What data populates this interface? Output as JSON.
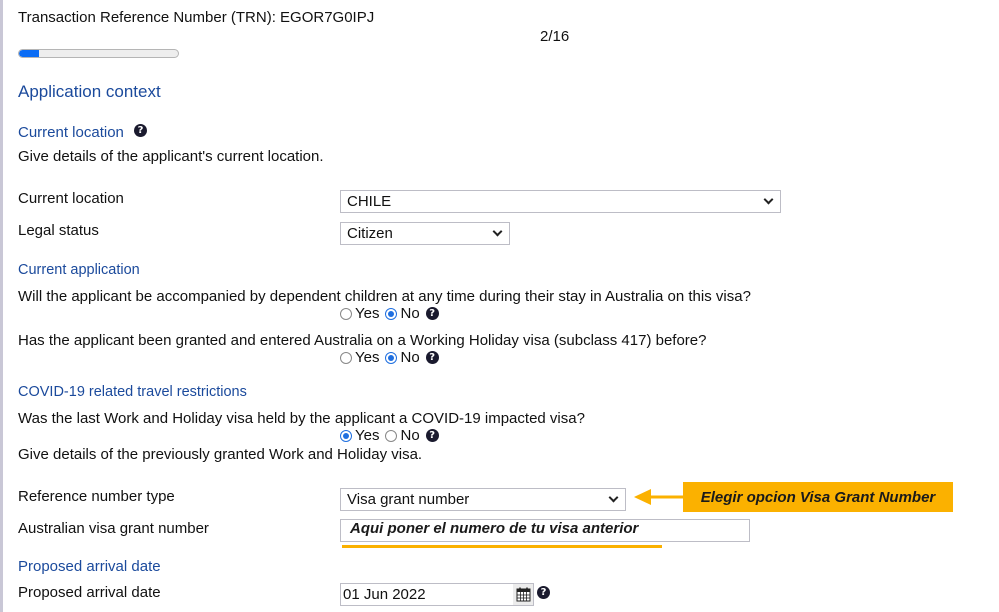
{
  "header": {
    "trn_label": "Transaction Reference Number (TRN): EGOR7G0IPJ",
    "page_counter": "2/16",
    "progress_fraction": 0.125
  },
  "section_title": "Application context",
  "current_location_section": {
    "heading": "Current location",
    "description": "Give details of the applicant's current location.",
    "fields": {
      "current_location": {
        "label": "Current location",
        "value": "CHILE"
      },
      "legal_status": {
        "label": "Legal status",
        "value": "Citizen"
      }
    }
  },
  "current_application": {
    "heading": "Current application",
    "q1": {
      "text": "Will the applicant be accompanied by dependent children at any time during their stay in Australia on this visa?",
      "yes": "Yes",
      "no": "No",
      "selected": "No"
    },
    "q2": {
      "text": "Has the applicant been granted and entered Australia on a Working Holiday visa (subclass 417) before?",
      "yes": "Yes",
      "no": "No",
      "selected": "No"
    }
  },
  "covid": {
    "heading": "COVID-19 related travel restrictions",
    "q1": {
      "text": "Was the last Work and Holiday visa held by the applicant a COVID-19 impacted visa?",
      "yes": "Yes",
      "no": "No",
      "selected": "Yes"
    },
    "description": "Give details of the previously granted Work and Holiday visa.",
    "reference_type": {
      "label": "Reference number type",
      "value": "Visa grant number"
    },
    "grant_number": {
      "label": "Australian visa grant number",
      "value": ""
    }
  },
  "arrival": {
    "heading": "Proposed arrival date",
    "label": "Proposed arrival date",
    "value": "01 Jun 2022"
  },
  "annotations": {
    "arrow_note": "Elegir opcion Visa Grant Number",
    "input_note": "Aqui poner el numero de tu visa anterior",
    "color": "#fbb100"
  },
  "icons": {
    "help": "?",
    "calendar": "calendar-icon"
  }
}
